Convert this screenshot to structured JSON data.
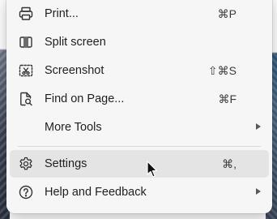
{
  "menu": {
    "items": [
      {
        "label": "Print...",
        "shortcut": "⌘P",
        "icon": "printer-icon"
      },
      {
        "label": "Split screen",
        "shortcut": "",
        "icon": "split-screen-icon"
      },
      {
        "label": "Screenshot",
        "shortcut": "⇧⌘S",
        "icon": "screenshot-icon"
      },
      {
        "label": "Find on Page...",
        "shortcut": "⌘F",
        "icon": "find-on-page-icon"
      },
      {
        "label": "More Tools",
        "shortcut": "",
        "icon": ""
      },
      {
        "label": "Settings",
        "shortcut": "⌘,",
        "icon": "gear-icon"
      },
      {
        "label": "Help and Feedback",
        "shortcut": "",
        "icon": "help-icon"
      }
    ]
  },
  "colors": {
    "menu_background": "#f6f6f6",
    "hover_background": "#e4e4e4",
    "text": "#1f1f1f"
  }
}
